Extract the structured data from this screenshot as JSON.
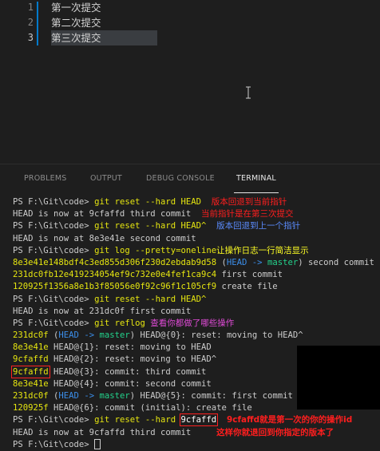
{
  "editor": {
    "line_numbers": [
      "1",
      "2",
      "3"
    ],
    "lines": [
      "第一次提交",
      "第二次提交",
      "第三次提交"
    ]
  },
  "panel": {
    "tabs": [
      "PROBLEMS",
      "OUTPUT",
      "DEBUG CONSOLE",
      "TERMINAL"
    ],
    "active_tab": "TERMINAL"
  },
  "terminal": {
    "prompt": "PS F:\\Git\\code>",
    "cmd1": "git reset --hard HEAD",
    "note1": "版本回退到当前指针",
    "out1": "HEAD is now at 9cfaffd third commit",
    "note2": "当前指针是在第三次提交",
    "cmd2": "git reset --hard HEAD^",
    "note3": "版本回退到上一个指针",
    "out2": "HEAD is now at 8e3e41e second commit",
    "cmd3": "git log --pretty=oneline",
    "note4": "让操作日志一行简洁显示",
    "log1_hash": "8e3e41e148bdf4c3ed855d306f230d2ebdab9d58",
    "log1_head": "HEAD",
    "log1_arrow": "->",
    "log1_master": "master",
    "log1_msg": "second commit",
    "log2_hash": "231dc0fb12e419234054ef9c732e0e4fef1ca9c4",
    "log2_msg": "first commit",
    "log3_hash": "120925f1356a8e1b3f85056e0f92c96f1c105cf9",
    "log3_msg": "create file",
    "cmd4": "git reset --hard HEAD^",
    "out3": "HEAD is now at 231dc0f first commit",
    "cmd5": "git reflog",
    "note5": "查看你都做了哪些操作",
    "reflog": [
      {
        "hash": "231dc0f",
        "ref": "HEAD@{0}: reset: moving to HEAD^",
        "decor": true,
        "boxed": false
      },
      {
        "hash": "8e3e41e",
        "ref": "HEAD@{1}: reset: moving to HEAD",
        "decor": false,
        "boxed": false
      },
      {
        "hash": "9cfaffd",
        "ref": "HEAD@{2}: reset: moving to HEAD^",
        "decor": false,
        "boxed": false
      },
      {
        "hash": "9cfaffd",
        "ref": "HEAD@{3}: commit: third commit",
        "decor": false,
        "boxed": true
      },
      {
        "hash": "8e3e41e",
        "ref": "HEAD@{4}: commit: second commit",
        "decor": false,
        "boxed": false
      },
      {
        "hash": "231dc0f",
        "ref": "HEAD@{5}: commit: first commit",
        "decor": true,
        "boxed": false
      },
      {
        "hash": "120925f",
        "ref": "HEAD@{6}: commit (initial): create file",
        "decor": false,
        "boxed": false
      }
    ],
    "decor_head": "HEAD",
    "decor_arrow": "->",
    "decor_master": "master",
    "cmd6": "git reset --hard",
    "cmd6_arg": "9cfaffd",
    "note6": "9cfaffd就是第一次的你的操作id",
    "out4": "HEAD is now at 9cfaffd third commit",
    "note7": "这样你就退回到你指定的版本了"
  }
}
